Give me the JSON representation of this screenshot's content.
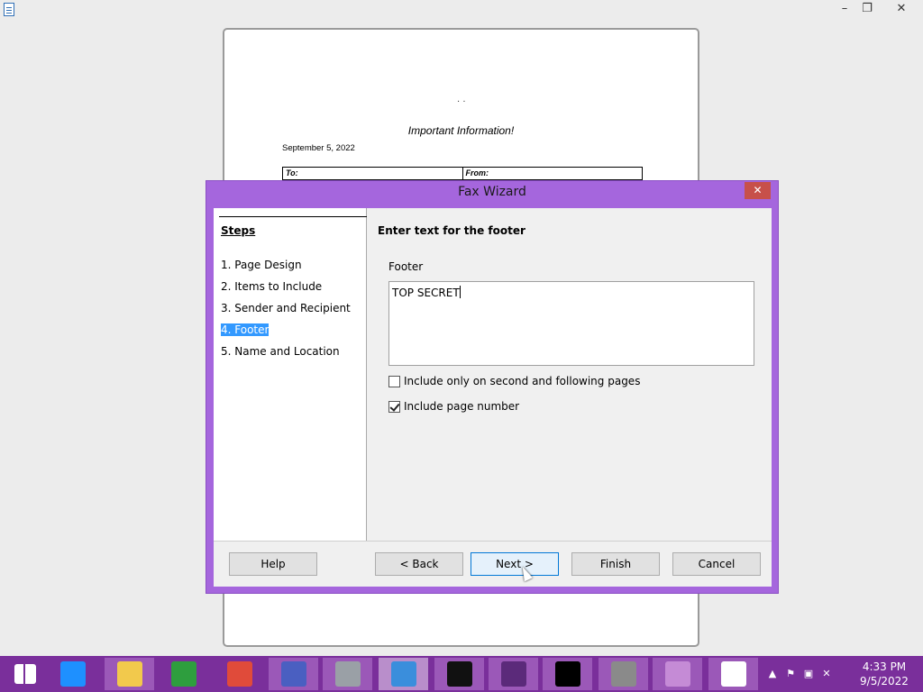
{
  "window": {
    "minimize_glyph": "–",
    "restore_glyph": "❐",
    "close_glyph": "✕"
  },
  "document": {
    "dots": ". .",
    "title": "Important Information!",
    "date": "September 5, 2022",
    "to_label": "To:",
    "from_label": "From:"
  },
  "dialog": {
    "title": "Fax Wizard",
    "close_glyph": "✕",
    "steps_title": "Steps",
    "steps": [
      {
        "label": "1. Page Design",
        "active": false
      },
      {
        "label": "2. Items to Include",
        "active": false
      },
      {
        "label": "3. Sender and Recipient",
        "active": false
      },
      {
        "label": "4. Footer",
        "active": true
      },
      {
        "label": "5. Name and Location",
        "active": false
      }
    ],
    "heading": "Enter text for the footer",
    "footer_label": "Footer",
    "footer_value": "TOP SECRET",
    "checkbox_second_pages": {
      "label": "Include only on second and following pages",
      "checked": false
    },
    "checkbox_page_number": {
      "label": "Include page number",
      "checked": true
    },
    "buttons": {
      "help": "Help",
      "back": "< Back",
      "next": "Next >",
      "finish": "Finish",
      "cancel": "Cancel"
    }
  },
  "taskbar": {
    "items": [
      {
        "name": "start",
        "icon": "windows-logo-icon",
        "color": "#ffffff"
      },
      {
        "name": "internet-explorer",
        "icon": "internet-explorer-icon",
        "color": "#1e90ff"
      },
      {
        "name": "file-explorer",
        "icon": "folder-icon",
        "color": "#f2c94c"
      },
      {
        "name": "store",
        "icon": "store-icon",
        "color": "#2e9e3e"
      },
      {
        "name": "chrome",
        "icon": "chrome-icon",
        "color": "#e04b3a"
      },
      {
        "name": "settings",
        "icon": "gear-icon",
        "color": "#4a5fc1"
      },
      {
        "name": "installer",
        "icon": "installer-icon",
        "color": "#9aa0a6"
      },
      {
        "name": "thunderbird",
        "icon": "thunderbird-icon",
        "color": "#3a8edc"
      },
      {
        "name": "7zip",
        "icon": "7zip-icon",
        "color": "#111111"
      },
      {
        "name": "media-player",
        "icon": "media-player-icon",
        "color": "#5b2a7a"
      },
      {
        "name": "command-prompt",
        "icon": "terminal-icon",
        "color": "#000000"
      },
      {
        "name": "firewall",
        "icon": "firewall-icon",
        "color": "#8a8a8a"
      },
      {
        "name": "libreoffice-base",
        "icon": "database-icon",
        "color": "#c58bd6"
      },
      {
        "name": "libreoffice-writer",
        "icon": "document-icon",
        "color": "#ffffff"
      }
    ],
    "clock_time": "4:33 PM",
    "clock_date": "9/5/2022"
  }
}
